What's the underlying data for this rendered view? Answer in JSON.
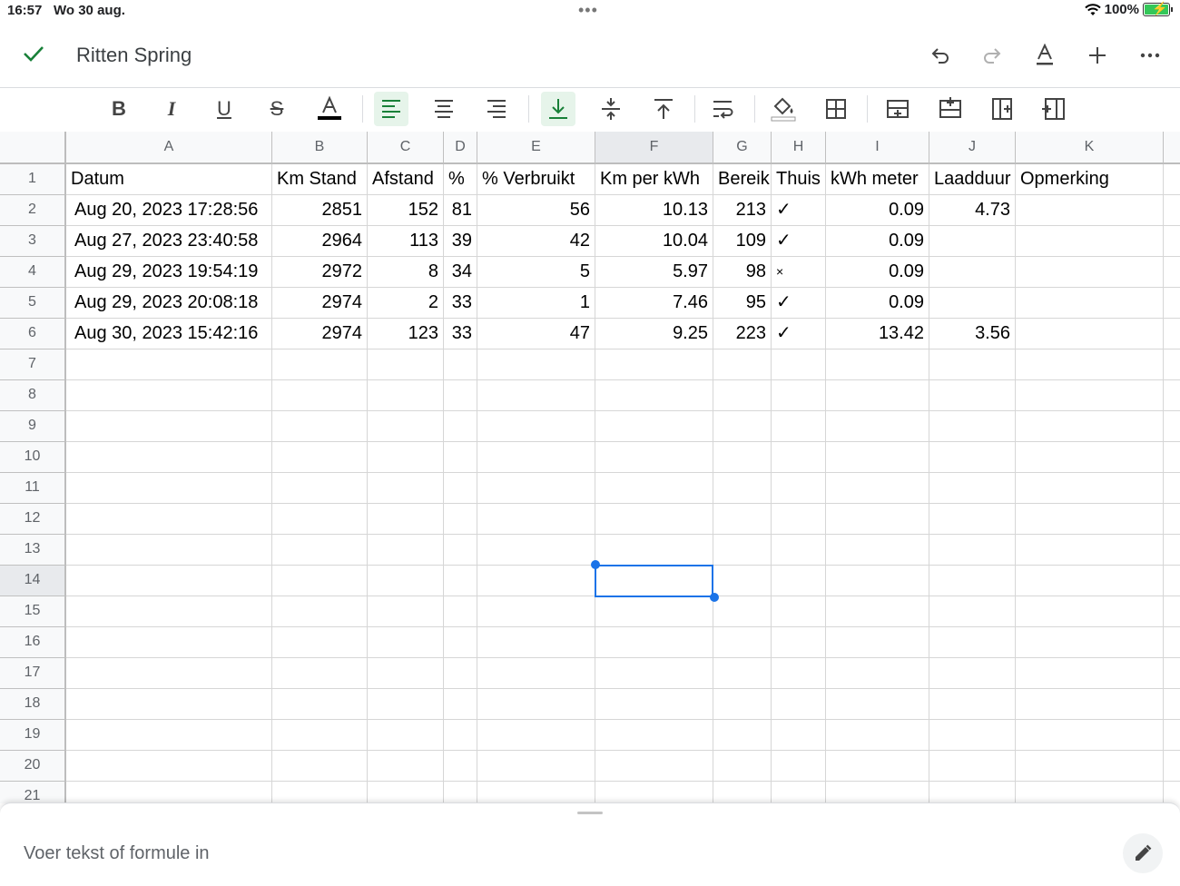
{
  "status_bar": {
    "time": "16:57",
    "date": "Wo 30 aug.",
    "battery": "100%"
  },
  "header": {
    "title": "Ritten Spring"
  },
  "formula_bar": {
    "placeholder": "Voer tekst of formule in"
  },
  "sheet": {
    "columns": [
      "A",
      "B",
      "C",
      "D",
      "E",
      "F",
      "G",
      "H",
      "I",
      "J",
      "K"
    ],
    "selected_column": "F",
    "selected_row": "14",
    "row_numbers": [
      "1",
      "2",
      "3",
      "4",
      "5",
      "6",
      "7",
      "8",
      "9",
      "10",
      "11",
      "12",
      "13",
      "14",
      "15",
      "16",
      "17",
      "18",
      "19",
      "20",
      "21"
    ],
    "header_row": [
      "Datum",
      "Km Stand",
      "Afstand",
      "%",
      "% Verbruikt",
      "Km per kWh",
      "Bereik",
      "Thuis",
      "kWh meter",
      "Laadduur",
      "Opmerking"
    ],
    "rows": [
      [
        "Aug 20, 2023 17:28:56",
        "2851",
        "152",
        "81",
        "56",
        "10.13",
        "213",
        "✓",
        "0.09",
        "4.73",
        ""
      ],
      [
        "Aug 27, 2023 23:40:58",
        "2964",
        "113",
        "39",
        "42",
        "10.04",
        "109",
        "✓",
        "0.09",
        "",
        ""
      ],
      [
        "Aug 29, 2023 19:54:19",
        "2972",
        "8",
        "34",
        "5",
        "5.97",
        "98",
        "×",
        "0.09",
        "",
        ""
      ],
      [
        "Aug 29, 2023 20:08:18",
        "2974",
        "2",
        "33",
        "1",
        "7.46",
        "95",
        "✓",
        "0.09",
        "",
        ""
      ],
      [
        "Aug 30, 2023 15:42:16",
        "2974",
        "123",
        "33",
        "47",
        "9.25",
        "223",
        "✓",
        "13.42",
        "3.56",
        ""
      ]
    ]
  },
  "colors": {
    "accent": "#1a73e8",
    "check": "#188038",
    "active_toolbar": "#e6f4ea"
  }
}
